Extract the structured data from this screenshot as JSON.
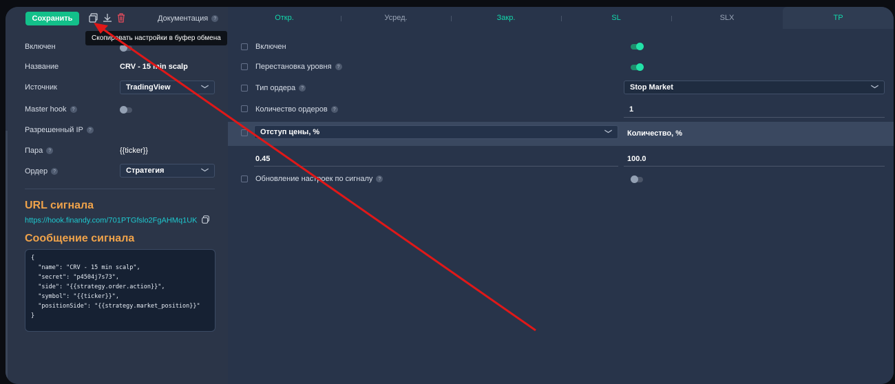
{
  "left": {
    "toolbar": {
      "save": "Сохранить",
      "docs": "Документация",
      "tooltip": "Скопировать настройки в буфер обмена"
    },
    "fields": [
      {
        "label": "Включен",
        "value": ""
      },
      {
        "label": "Название",
        "value": "CRV - 15 min scalp"
      },
      {
        "label": "Источник",
        "value": "TradingView"
      },
      {
        "label": "Master hook",
        "value": ""
      },
      {
        "label": "Разрешенный IP",
        "value": ""
      },
      {
        "label": "Пара",
        "value": "{{ticker}}"
      },
      {
        "label": "Ордер",
        "value": "Стратегия"
      }
    ],
    "url_section": {
      "title": "URL сигнала",
      "url": "https://hook.finandy.com/701PTGfslo2FgAHMq1UK"
    },
    "message_section": {
      "title": "Сообщение сигнала",
      "code": "{\n  \"name\": \"CRV - 15 min scalp\",\n  \"secret\": \"p4504j7s73\",\n  \"side\": \"{{strategy.order.action}}\",\n  \"symbol\": \"{{ticker}}\",\n  \"positionSide\": \"{{strategy.market_position}}\"\n}"
    }
  },
  "tabs": [
    "Откр.",
    "Усред.",
    "Закр.",
    "SL",
    "SLX",
    "TP"
  ],
  "right": {
    "rows": [
      {
        "label": "Включен"
      },
      {
        "label": "Перестановка уровня"
      },
      {
        "label": "Тип ордера",
        "value": "Stop Market"
      },
      {
        "label": "Количество ордеров",
        "value": "1"
      }
    ],
    "band": {
      "dropdown": "Отступ цены, %",
      "label": "Количество, %"
    },
    "values": {
      "price": "0.45",
      "qty": "100.0"
    },
    "update_label": "Обновление настроек по сигналу"
  },
  "colors": {
    "accent": "#13c08a",
    "link": "#1ec9cf",
    "orange": "#f0a34a",
    "arrow": "#e01818"
  }
}
